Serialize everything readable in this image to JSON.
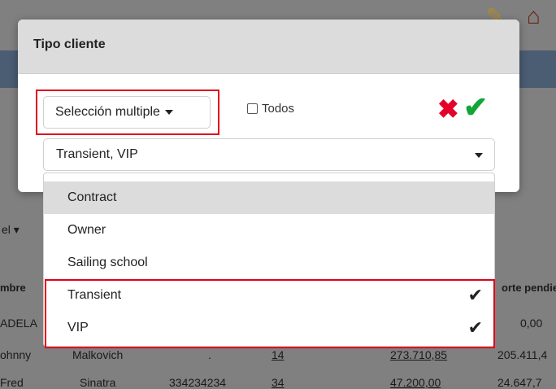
{
  "modal": {
    "title": "Tipo cliente",
    "selection_mode": "Selección multiple",
    "todos_label": "Todos",
    "selected_value": "Transient, VIP",
    "options": [
      {
        "label": "Contract",
        "selected": false
      },
      {
        "label": "Owner",
        "selected": false
      },
      {
        "label": "Sailing school",
        "selected": false
      },
      {
        "label": "Transient",
        "selected": true
      },
      {
        "label": "VIP",
        "selected": true
      }
    ],
    "check_glyph": "✔"
  },
  "background": {
    "left_select_fragment": "el",
    "col_nombre_fragment": "mbre",
    "col_importe_fragment": "orte pendie",
    "rows": [
      {
        "first": "ADELA",
        "amount": "0,00"
      },
      {
        "first": "ohnny",
        "last": "Malkovich",
        "dot": ".",
        "count": "14",
        "total": "273.710,85",
        "pending": "205.411,4"
      },
      {
        "first": "Fred",
        "last": "Sinatra",
        "code": "334234234",
        "count": "34",
        "total": "47.200,00",
        "pending": "24.647,7"
      }
    ]
  },
  "icons": {
    "edit": "pencil-icon",
    "home": "home-icon",
    "cancel": "x-icon",
    "confirm": "checkmark-icon"
  },
  "colors": {
    "cancel": "#e5002a",
    "confirm": "#12a538",
    "highlight": "#e0001b"
  }
}
